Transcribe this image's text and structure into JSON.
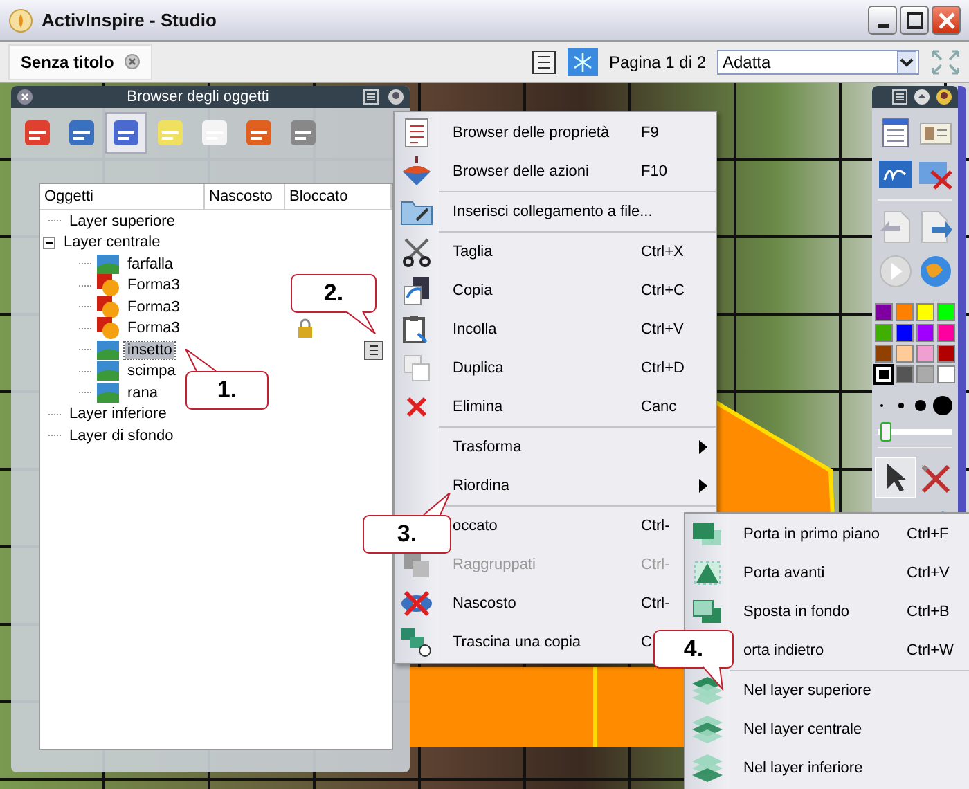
{
  "window": {
    "title": "ActivInspire - Studio"
  },
  "document_tab": {
    "label": "Senza titolo",
    "selected": true
  },
  "toolbar": {
    "page_label": "Pagina 1 di 2",
    "zoom": "Adatta"
  },
  "object_browser": {
    "title": "Browser degli oggetti",
    "view_buttons": [
      {
        "selected": false
      },
      {
        "selected": false
      },
      {
        "selected": true
      },
      {
        "selected": false
      },
      {
        "selected": false
      },
      {
        "selected": false
      },
      {
        "selected": false
      }
    ],
    "columns": [
      "Oggetti",
      "Nascosto",
      "Bloccato"
    ],
    "tree": [
      {
        "label": "Layer superiore",
        "kind": "layer",
        "selected": false
      },
      {
        "label": "Layer centrale",
        "kind": "layer",
        "selected": false,
        "expanded": true,
        "children": [
          {
            "label": "farfalla",
            "kind": "image",
            "selected": false,
            "locked": false
          },
          {
            "label": "Forma3",
            "kind": "shape",
            "selected": false,
            "locked": false
          },
          {
            "label": "Forma3",
            "kind": "shape",
            "selected": false,
            "locked": false
          },
          {
            "label": "Forma3",
            "kind": "shape",
            "selected": false,
            "locked": true
          },
          {
            "label": "insetto",
            "kind": "image",
            "selected": true,
            "locked": false
          },
          {
            "label": "scimpa",
            "kind": "image",
            "selected": false,
            "locked": false
          },
          {
            "label": "rana",
            "kind": "image",
            "selected": false,
            "locked": false
          }
        ]
      },
      {
        "label": "Layer inferiore",
        "kind": "layer",
        "selected": false
      },
      {
        "label": "Layer di sfondo",
        "kind": "layer",
        "selected": false
      }
    ]
  },
  "context_menu": [
    {
      "kind": "item",
      "label": "Browser delle proprietà",
      "shortcut": "F9",
      "disabled": false
    },
    {
      "kind": "item",
      "label": "Browser delle azioni",
      "shortcut": "F10",
      "disabled": false
    },
    {
      "kind": "separator"
    },
    {
      "kind": "item",
      "label": "Inserisci collegamento a file...",
      "disabled": false
    },
    {
      "kind": "separator"
    },
    {
      "kind": "item",
      "label": "Taglia",
      "shortcut": "Ctrl+X",
      "disabled": false
    },
    {
      "kind": "item",
      "label": "Copia",
      "shortcut": "Ctrl+C",
      "disabled": false
    },
    {
      "kind": "item",
      "label": "Incolla",
      "shortcut": "Ctrl+V",
      "disabled": false
    },
    {
      "kind": "item",
      "label": "Duplica",
      "shortcut": "Ctrl+D",
      "disabled": false
    },
    {
      "kind": "item",
      "label": "Elimina",
      "shortcut": "Canc",
      "disabled": false
    },
    {
      "kind": "separator"
    },
    {
      "kind": "submenu",
      "label": "Trasforma",
      "disabled": false
    },
    {
      "kind": "submenu",
      "label": "Riordina",
      "disabled": false
    },
    {
      "kind": "separator"
    },
    {
      "kind": "item",
      "label": "occato",
      "shortcut": "Ctrl-",
      "disabled": false
    },
    {
      "kind": "item",
      "label": "Raggruppati",
      "shortcut": "Ctrl-",
      "disabled": true
    },
    {
      "kind": "item",
      "label": "Nascosto",
      "shortcut": "Ctrl-",
      "disabled": false
    },
    {
      "kind": "item",
      "label": "Trascina una copia",
      "shortcut": "C",
      "disabled": false
    }
  ],
  "submenu": [
    {
      "kind": "item",
      "label": "Porta in primo piano",
      "shortcut": "Ctrl+F"
    },
    {
      "kind": "item",
      "label": "Porta avanti",
      "shortcut": "Ctrl+V"
    },
    {
      "kind": "item",
      "label": "Sposta in fondo",
      "shortcut": "Ctrl+B"
    },
    {
      "kind": "item",
      "label": "orta indietro",
      "shortcut": "Ctrl+W"
    },
    {
      "kind": "separator"
    },
    {
      "kind": "item",
      "label": "Nel layer superiore"
    },
    {
      "kind": "item",
      "label": "Nel layer centrale"
    },
    {
      "kind": "item",
      "label": "Nel layer inferiore"
    }
  ],
  "toolbox": {
    "palette": [
      {
        "color": "#7f00a0",
        "selected": false
      },
      {
        "color": "#ff8000",
        "selected": false
      },
      {
        "color": "#ffff00",
        "selected": false
      },
      {
        "color": "#00ff00",
        "selected": false
      },
      {
        "color": "#40b000",
        "selected": false
      },
      {
        "color": "#0000ff",
        "selected": false
      },
      {
        "color": "#a000ff",
        "selected": false
      },
      {
        "color": "#ff00a0",
        "selected": false
      },
      {
        "color": "#904000",
        "selected": false
      },
      {
        "color": "#ffcc99",
        "selected": false
      },
      {
        "color": "#f0a0d0",
        "selected": false
      },
      {
        "color": "#b00000",
        "selected": false
      },
      {
        "color": "#000000",
        "selected": true
      },
      {
        "color": "#555555",
        "selected": false
      },
      {
        "color": "#aaaaaa",
        "selected": false
      },
      {
        "color": "#ffffff",
        "selected": false
      }
    ],
    "thickness": {
      "level": 0.05
    }
  },
  "callouts": [
    "1.",
    "2.",
    "3.",
    "4."
  ]
}
